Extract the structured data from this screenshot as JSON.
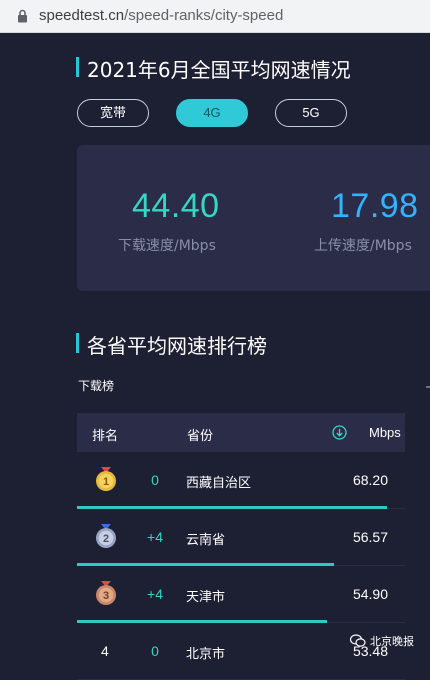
{
  "browser": {
    "url_host": "speedtest.cn",
    "url_path": "/speed-ranks/city-speed"
  },
  "summary": {
    "title": "2021年6月全国平均网速情况",
    "tabs": [
      {
        "label": "宽带",
        "active": false
      },
      {
        "label": "4G",
        "active": true
      },
      {
        "label": "5G",
        "active": false
      }
    ],
    "download": {
      "value": "44.40",
      "label": "下载速度/Mbps"
    },
    "upload": {
      "value": "17.98",
      "label": "上传速度/Mbps"
    }
  },
  "ranking": {
    "title": "各省平均网速排行榜",
    "subhead": "下载榜",
    "columns": {
      "rank": "排名",
      "province": "省份",
      "speed": "Mbps"
    },
    "rows": [
      {
        "rank": "1",
        "change": "0",
        "province": "西藏自治区",
        "speed": 68.2,
        "medal": "gold"
      },
      {
        "rank": "2",
        "change": "+4",
        "province": "云南省",
        "speed": 56.57,
        "medal": "silver"
      },
      {
        "rank": "3",
        "change": "+4",
        "province": "天津市",
        "speed": 54.9,
        "medal": "bronze"
      },
      {
        "rank": "4",
        "change": "0",
        "province": "北京市",
        "speed": 53.48,
        "medal": ""
      }
    ],
    "speed_max": 68.2
  },
  "watermark": {
    "text": "北京晚报"
  },
  "colors": {
    "accent": "#2fc9d8",
    "download": "#36d6c6",
    "upload": "#2fb4ff",
    "background": "#1d1f33",
    "card": "#2b2d48"
  }
}
